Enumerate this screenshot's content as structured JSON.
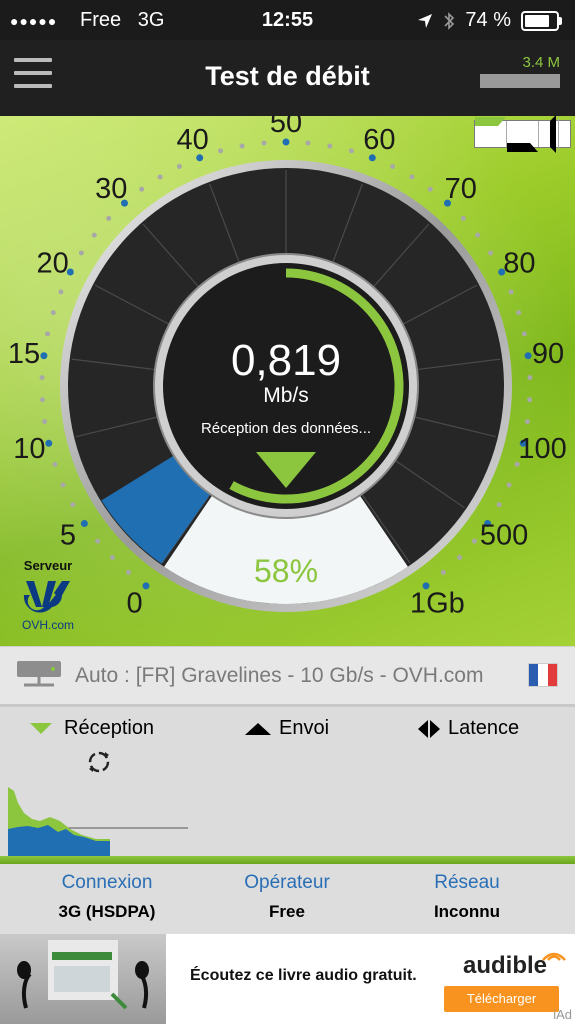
{
  "status_bar": {
    "signal": "●●●●●",
    "carrier": "Free",
    "network": "3G",
    "time": "12:55",
    "battery": "74 %"
  },
  "header": {
    "title": "Test de débit",
    "data_usage": "3.4 M"
  },
  "gauge": {
    "speed": "0,819",
    "unit": "Mb/s",
    "status": "Réception des données...",
    "progress_percent": "58%",
    "progress_fraction": 0.58,
    "needle_fraction": 0.08,
    "scale_labels": [
      "0",
      "5",
      "10",
      "15",
      "20",
      "30",
      "40",
      "50",
      "60",
      "70",
      "80",
      "90",
      "100",
      "500",
      "1Gb"
    ]
  },
  "server": {
    "label": "Serveur",
    "domain": "OVH.com",
    "description": "Auto : [FR] Gravelines - 10 Gb/s - OVH.com"
  },
  "tabs": {
    "reception": "Réception",
    "envoi": "Envoi",
    "latence": "Latence"
  },
  "info": {
    "connexion_label": "Connexion",
    "connexion_value": "3G (HSDPA)",
    "operateur_label": "Opérateur",
    "operateur_value": "Free",
    "reseau_label": "Réseau",
    "reseau_value": "Inconnu"
  },
  "ad": {
    "text": "Écoutez ce livre audio gratuit.",
    "brand": "audible",
    "cta": "Télécharger",
    "iad": "iAd"
  },
  "colors": {
    "accent_green": "#8cc63f",
    "accent_blue": "#1f6fb2",
    "link_blue": "#2a6fb5"
  },
  "icons": [
    "menu-icon",
    "location-arrow-icon",
    "bluetooth-icon",
    "battery-icon",
    "download-arrow-icon",
    "upload-arrow-icon",
    "latency-icon",
    "refresh-icon",
    "server-icon",
    "flag-icon"
  ]
}
